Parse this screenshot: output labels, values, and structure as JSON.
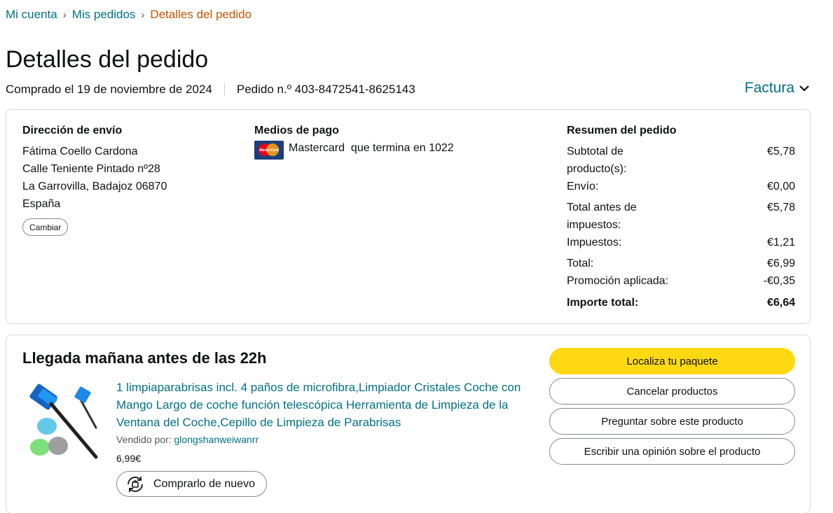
{
  "breadcrumb": {
    "items": [
      "Mi cuenta",
      "Mis pedidos"
    ],
    "current": "Detalles del pedido"
  },
  "page_title": "Detalles del pedido",
  "order_meta": {
    "purchased": "Comprado el 19 de noviembre de 2024",
    "order_number": "Pedido n.º 403-8472541-8625143"
  },
  "invoice_label": "Factura",
  "shipping": {
    "title": "Dirección de envío",
    "lines": [
      "Fátima Coello Cardona",
      "Calle Teniente Pintado nº28",
      "La Garrovilla, Badajoz 06870",
      "España"
    ],
    "change_button": "Cambiar"
  },
  "payment": {
    "title": "Medios de pago",
    "method": "Mastercard  que termina en 1022",
    "card_logo_text": "MasterCard"
  },
  "summary": {
    "title": "Resumen del pedido",
    "rows": [
      {
        "label": "Subtotal de producto(s):",
        "value": "€5,78"
      },
      {
        "label": "Envío:",
        "value": "€0,00"
      },
      {
        "label": "Total antes de impuestos:",
        "value": "€5,78"
      },
      {
        "label": "Impuestos:",
        "value": "€1,21"
      },
      {
        "label": "Total:",
        "value": "€6,99"
      },
      {
        "label": "Promoción aplicada:",
        "value": "-€0,35"
      },
      {
        "label": "Importe total:",
        "value": "€6,64"
      }
    ]
  },
  "shipment": {
    "arrival": "Llegada mañana antes de las 22h",
    "product_title": "1 limpiaparabrisas incl. 4 paños de microfibra,Limpiador Cristales Coche con Mango Largo de coche función telescópica Herramienta de Limpieza de la Ventana del Coche,Cepillo de Limpieza de Parabrisas",
    "seller_label": "Vendido por:",
    "seller_name": "glongshanweiwanrr",
    "price": "6,99€",
    "buy_again": "Comprarlo de nuevo"
  },
  "actions": {
    "track": "Localiza tu paquete",
    "cancel": "Cancelar productos",
    "ask": "Preguntar sobre este producto",
    "review": "Escribir una opinión sobre el producto"
  },
  "colors": {
    "link": "#007185",
    "breadcrumb_current": "#c45500",
    "primary_button": "#ffd814",
    "border": "#d5d9d9"
  }
}
